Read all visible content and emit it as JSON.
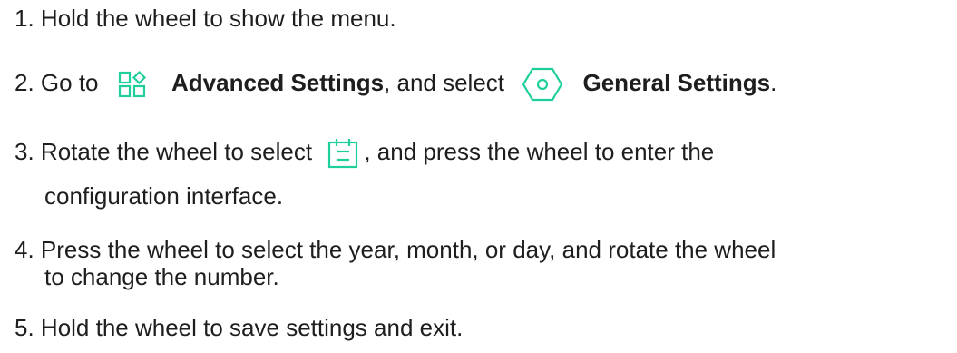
{
  "steps": [
    {
      "number": "1.",
      "text": "Hold the wheel to show the menu."
    },
    {
      "number": "2.",
      "prefix": "Go to",
      "advanced_label": "Advanced Settings",
      "middle": ", and select",
      "general_label": "General Settings",
      "suffix": "."
    },
    {
      "number": "3.",
      "prefix": "Rotate the wheel to select",
      "suffix": ", and press the wheel to enter the",
      "continuation": "configuration interface."
    },
    {
      "number": "4.",
      "text": "Press the wheel to select the year, month, or day, and rotate the wheel",
      "continuation": "to change the number."
    },
    {
      "number": "5.",
      "text": "Hold the wheel to save settings and exit."
    }
  ],
  "icons": {
    "advanced_settings": "apps-grid-icon",
    "general_settings": "hexagon-settings-icon",
    "date_setting": "calendar-icon"
  },
  "colors": {
    "text": "#1e1e1e",
    "accent": "#1fcf9b"
  }
}
